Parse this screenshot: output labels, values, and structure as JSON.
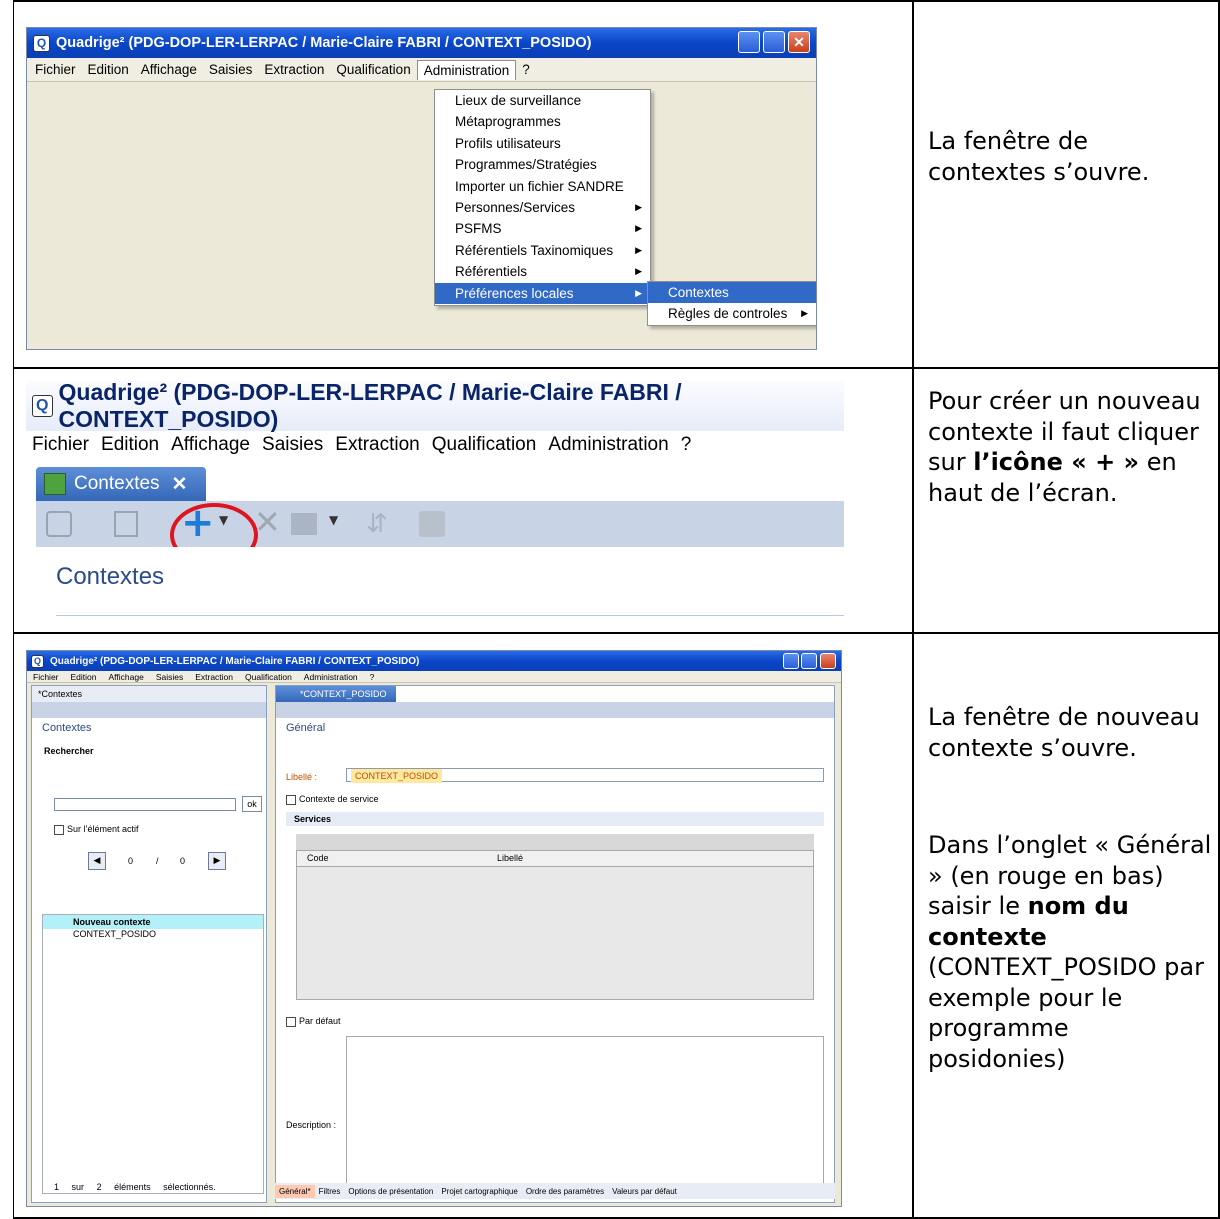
{
  "rows": [
    {
      "description": "La fenêtre de contextes s’ouvre."
    },
    {
      "description_parts": [
        "Pour créer un nouveau contexte il faut cliquer sur ",
        "l’icône « + »",
        " en haut de l’écran."
      ]
    },
    {
      "description_1": "La fenêtre de nouveau contexte s’ouvre.",
      "description_2a": "Dans l’onglet « Général » (en rouge en bas) saisir le ",
      "description_2b": "nom du contexte",
      "description_2c": " (CONTEXT_POSIDO par exemple pour le programme posidonies)"
    }
  ],
  "app": {
    "title": "Quadrige² (PDG-DOP-LER-LERPAC / Marie-Claire FABRI / CONTEXT_POSIDO)",
    "menu": [
      "Fichier",
      "Edition",
      "Affichage",
      "Saisies",
      "Extraction",
      "Qualification",
      "Administration",
      "?"
    ],
    "admin_menu": [
      "Lieux de surveillance",
      "Métaprogrammes",
      "Profils utilisateurs",
      "Programmes/Stratégies",
      "Importer un fichier SANDRE",
      "Personnes/Services",
      "PSFMS",
      "Référentiels Taxinomiques",
      "Référentiels",
      "Préférences locales"
    ],
    "submenu": [
      "Contextes",
      "Règles de controles"
    ],
    "tab_contextes": "Contextes",
    "heading": "Contextes"
  },
  "shot3": {
    "left_tab": "*Contextes",
    "right_tab": "*CONTEXT_POSIDO",
    "left_heading": "Contextes",
    "right_heading": "Général",
    "search_label": "Rechercher",
    "ok": "ok",
    "active_elem": "Sur l’élément actif",
    "counter_a": "0",
    "counter_sep": "/",
    "counter_b": "0",
    "tree": [
      "Nouveau contexte",
      "CONTEXT_POSIDO"
    ],
    "footer": [
      "1",
      "sur",
      "2",
      "éléments sélectionnés."
    ],
    "libelle_label": "Libellé :",
    "libelle_value": "CONTEXT_POSIDO",
    "ctx_service": "Contexte de service",
    "services": "Services",
    "col_code": "Code",
    "col_libelle": "Libellé",
    "par_defaut": "Par défaut",
    "description": "Description :",
    "bottom_tabs": [
      "Général*",
      "Filtres",
      "Options de présentation",
      "Projet cartographique",
      "Ordre des paramètres",
      "Valeurs par défaut"
    ]
  }
}
